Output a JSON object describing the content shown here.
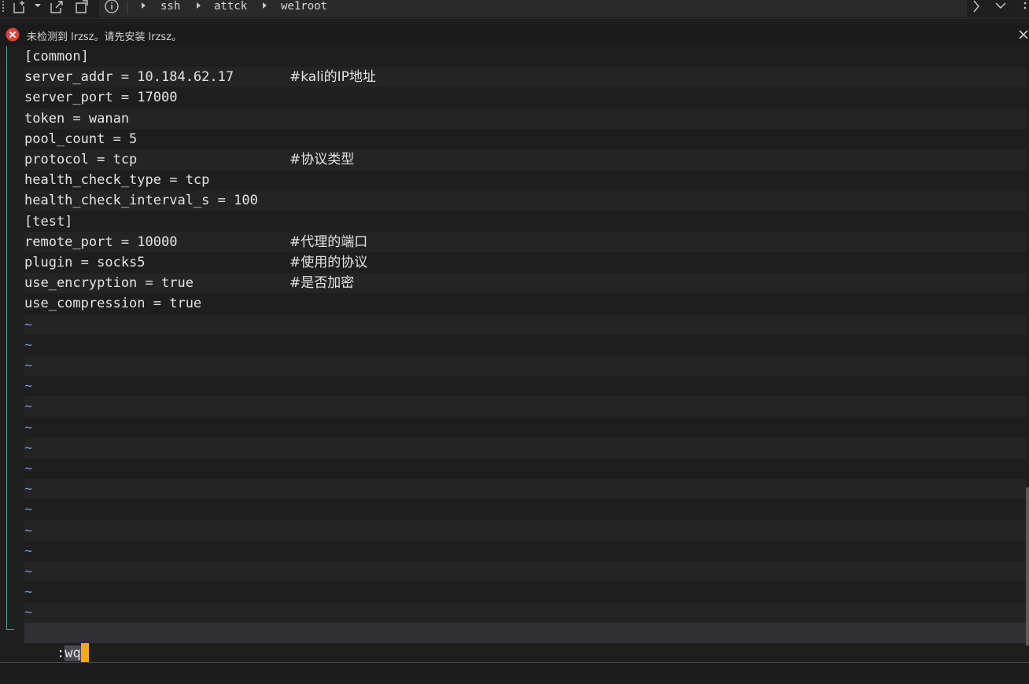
{
  "toolbar": {
    "icons": [
      "new-tab-icon",
      "dropdown-icon",
      "export-icon",
      "new-file-icon",
      "info-icon"
    ],
    "breadcrumbs": [
      "ssh",
      "attck",
      "we1root"
    ],
    "right_icons": [
      "chevron-right-icon",
      "chevron-down-icon",
      "more-icon"
    ]
  },
  "notice": {
    "icon": "error-icon",
    "text": "未检测到 lrzsz。请先安装 lrzsz。",
    "close_icon": "close-icon"
  },
  "editor": {
    "lines": [
      {
        "code": "[common]",
        "comment": ""
      },
      {
        "code": "server_addr = 10.184.62.17",
        "comment": "#kali的IP地址"
      },
      {
        "code": "server_port = 17000",
        "comment": ""
      },
      {
        "code": "token = wanan",
        "comment": ""
      },
      {
        "code": "pool_count = 5",
        "comment": ""
      },
      {
        "code": "protocol = tcp",
        "comment": "#协议类型"
      },
      {
        "code": "health_check_type = tcp",
        "comment": ""
      },
      {
        "code": "health_check_interval_s = 100",
        "comment": ""
      },
      {
        "code": "[test]",
        "comment": ""
      },
      {
        "code": "remote_port = 10000",
        "comment": "#代理的端口"
      },
      {
        "code": "plugin = socks5",
        "comment": "#使用的协议"
      },
      {
        "code": "use_encryption = true",
        "comment": "#是否加密"
      },
      {
        "code": "use_compression = true",
        "comment": ""
      }
    ],
    "empty_marker": "~",
    "empty_line_count": 15,
    "command_prefix": ":",
    "command_text": "wq"
  },
  "colors": {
    "background": "#1e1e1e",
    "text": "#e4e4e4",
    "tilde": "#6f8fd0",
    "cursor": "#f5a623",
    "guide": "#4aa3a8",
    "error": "#e0413a"
  }
}
